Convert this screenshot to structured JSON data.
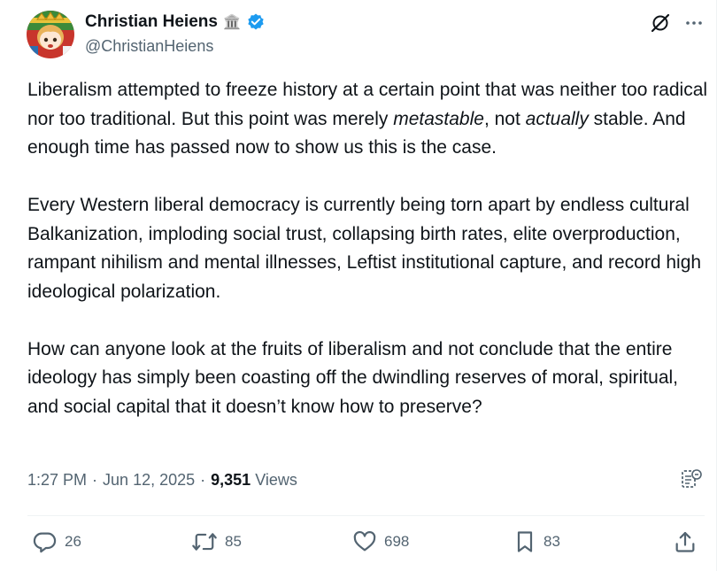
{
  "author": {
    "display_name": "Christian Heiens",
    "name_emoji": "🏛️",
    "handle": "@ChristianHeiens",
    "verified": true
  },
  "icons": {
    "grok": "grok-icon",
    "more": "more-icon",
    "verified": "verified-badge-icon",
    "summary": "summary-icon",
    "reply": "reply-icon",
    "repost": "repost-icon",
    "like": "like-icon",
    "bookmark": "bookmark-icon",
    "share": "share-icon"
  },
  "colors": {
    "text": "#0f1419",
    "secondary": "#536471",
    "verified": "#1d9bf0",
    "divider": "#eff3f4"
  },
  "tweet": {
    "p1": {
      "a": "Liberalism attempted to freeze history at a certain point that was neither too radical nor too traditional. But this point was merely ",
      "em1": "metastable",
      "b": ", not ",
      "em2": "actually",
      "c": " stable. And enough time has passed now to show us this is the case."
    },
    "p2": "Every Western liberal democracy is currently being torn apart by endless cultural Balkanization, imploding social trust, collapsing birth rates, elite overproduction, rampant nihilism and mental illnesses, Leftist institutional capture, and record high ideological polarization.",
    "p3": "How can anyone look at the fruits of liberalism and not conclude that the entire ideology has simply been coasting off the dwindling reserves of moral, spiritual, and social capital that it doesn’t know how to preserve?"
  },
  "meta": {
    "time": "1:27 PM",
    "separator": "·",
    "date": "Jun 12, 2025",
    "views_count": "9,351",
    "views_label": "Views"
  },
  "actions": {
    "replies": "26",
    "reposts": "85",
    "likes": "698",
    "bookmarks": "83"
  }
}
